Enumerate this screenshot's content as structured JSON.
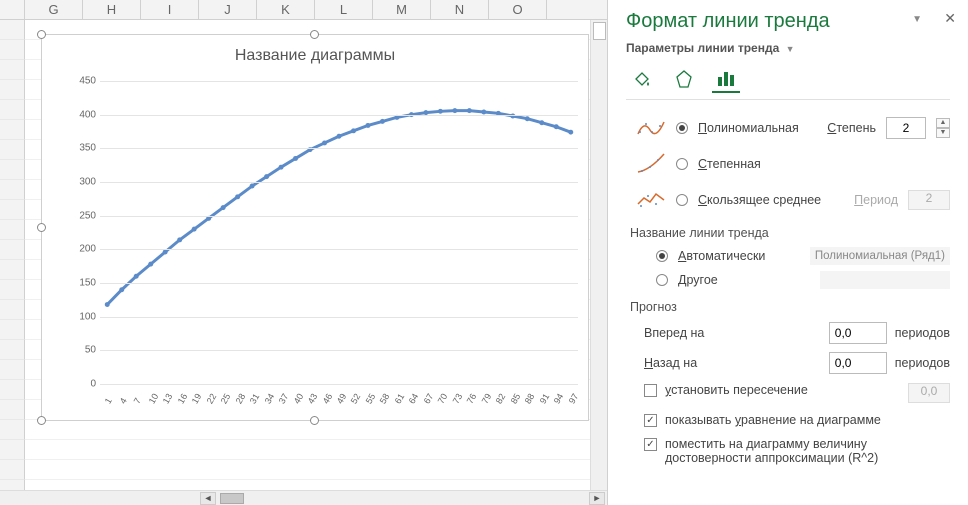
{
  "columns": [
    "G",
    "H",
    "I",
    "J",
    "K",
    "L",
    "M",
    "N",
    "O"
  ],
  "chart": {
    "title": "Название диаграммы",
    "y_ticks": [
      0,
      50,
      100,
      150,
      200,
      250,
      300,
      350,
      400,
      450
    ],
    "x_ticks": [
      1,
      4,
      7,
      10,
      13,
      16,
      19,
      22,
      25,
      28,
      31,
      34,
      37,
      40,
      43,
      46,
      49,
      52,
      55,
      58,
      61,
      64,
      67,
      70,
      73,
      76,
      79,
      82,
      85,
      88,
      91,
      94,
      97
    ]
  },
  "chart_data": {
    "type": "scatter",
    "title": "Название диаграммы",
    "xlabel": "",
    "ylabel": "",
    "xlim": [
      1,
      99
    ],
    "ylim": [
      0,
      450
    ],
    "x": [
      1,
      4,
      7,
      10,
      13,
      16,
      19,
      22,
      25,
      28,
      31,
      34,
      37,
      40,
      43,
      46,
      49,
      52,
      55,
      58,
      61,
      64,
      67,
      70,
      73,
      76,
      79,
      82,
      85,
      88,
      91,
      94,
      97
    ],
    "y": [
      118,
      140,
      160,
      178,
      196,
      214,
      230,
      246,
      262,
      278,
      294,
      308,
      322,
      335,
      348,
      358,
      368,
      376,
      384,
      390,
      396,
      400,
      403,
      405,
      406,
      406,
      404,
      402,
      398,
      394,
      388,
      382,
      374
    ],
    "trendline": {
      "type": "polynomial",
      "degree": 2
    }
  },
  "panel": {
    "title": "Формат линии тренда",
    "subtitle": "Параметры линии тренда",
    "options": {
      "poly": "Полиномиальная",
      "power": "Степенная",
      "movavg": "Скользящее среднее",
      "degree_label": "Степень",
      "degree_value": "2",
      "period_label": "Период",
      "period_value": "2"
    },
    "name_section": {
      "label": "Название линии тренда",
      "auto": "Автоматически",
      "auto_value": "Полиномиальная (Ряд1)",
      "other": "Другое"
    },
    "forecast": {
      "label": "Прогноз",
      "forward": "Вперед на",
      "backward": "Назад на",
      "fwd_value": "0,0",
      "bwd_value": "0,0",
      "periods": "периодов"
    },
    "checks": {
      "intercept": "установить пересечение",
      "intercept_value": "0,0",
      "show_eq": "показывать уравнение на диаграмме",
      "show_r2": "поместить на диаграмму величину достоверности аппроксимации (R^2)"
    }
  }
}
